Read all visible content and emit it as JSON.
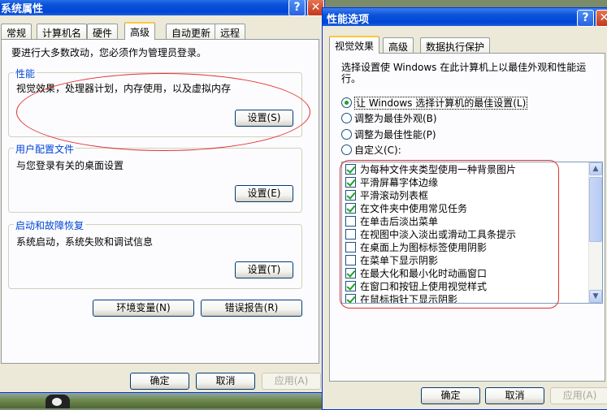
{
  "left_window": {
    "title": "系统属性",
    "tabs": [
      "常规",
      "计算机名",
      "硬件",
      "高级",
      "自动更新",
      "远程"
    ],
    "notice": "要进行大多数改动，您必须作为管理员登录。",
    "performance": {
      "title": "性能",
      "desc": "视觉效果，处理器计划，内存使用，以及虚拟内存",
      "button": "设置(S)"
    },
    "profiles": {
      "title": "用户配置文件",
      "desc": "与您登录有关的桌面设置",
      "button": "设置(E)"
    },
    "startup": {
      "title": "启动和故障恢复",
      "desc": "系统启动，系统失败和调试信息",
      "button": "设置(T)"
    },
    "env_button": "环境变量(N)",
    "error_button": "错误报告(R)",
    "ok": "确定",
    "cancel": "取消",
    "apply": "应用(A)"
  },
  "right_window": {
    "title": "性能选项",
    "tabs": [
      "视觉效果",
      "高级",
      "数据执行保护"
    ],
    "intro": "选择设置使 Windows 在此计算机上以最佳外观和性能运行。",
    "radios": [
      {
        "label": "让 Windows 选择计算机的最佳设置(L)",
        "selected": true
      },
      {
        "label": "调整为最佳外观(B)",
        "selected": false
      },
      {
        "label": "调整为最佳性能(P)",
        "selected": false
      },
      {
        "label": "自定义(C):",
        "selected": false
      }
    ],
    "effects": [
      {
        "label": "为每种文件夹类型使用一种背景图片",
        "checked": true
      },
      {
        "label": "平滑屏幕字体边缘",
        "checked": true
      },
      {
        "label": "平滑滚动列表框",
        "checked": true
      },
      {
        "label": "在文件夹中使用常见任务",
        "checked": true
      },
      {
        "label": "在单击后淡出菜单",
        "checked": false
      },
      {
        "label": "在视图中淡入淡出或滑动工具条提示",
        "checked": false
      },
      {
        "label": "在桌面上为图标标签使用阴影",
        "checked": false
      },
      {
        "label": "在菜单下显示阴影",
        "checked": false
      },
      {
        "label": "在最大化和最小化时动画窗口",
        "checked": true
      },
      {
        "label": "在窗口和按钮上使用视觉样式",
        "checked": true
      },
      {
        "label": "在鼠标指针下显示阴影",
        "checked": true
      }
    ],
    "ok": "确定",
    "cancel": "取消",
    "apply": "应用(A)"
  },
  "colors": {
    "titlebar": "#0a52d9",
    "dialog_bg": "#ece9d8",
    "group_title": "#0046d5",
    "annotation": "#e03030"
  },
  "icons": [
    "help-icon",
    "close-icon",
    "scroll-up-icon",
    "scroll-down-icon"
  ]
}
